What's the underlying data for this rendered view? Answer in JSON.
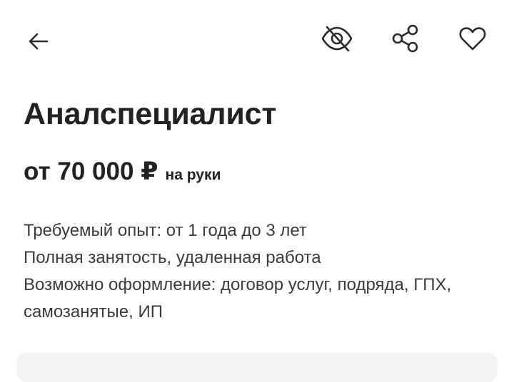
{
  "header": {
    "back_icon": "arrow-left-icon",
    "hide_icon": "eye-off-icon",
    "share_icon": "share-icon",
    "favorite_icon": "heart-icon"
  },
  "vacancy": {
    "title": "Аналспециалист",
    "salary": "от 70 000 ₽",
    "salary_note": "на руки",
    "experience": "Требуемый опыт: от 1 года до 3 лет",
    "employment": "Полная занятость, удаленная работа",
    "contract": "Возможно оформление: договор услуг, подряда, ГПХ, самозанятые, ИП"
  },
  "colors": {
    "text_primary": "#222222",
    "text_secondary": "#3b3b3b",
    "background": "#ffffff"
  }
}
